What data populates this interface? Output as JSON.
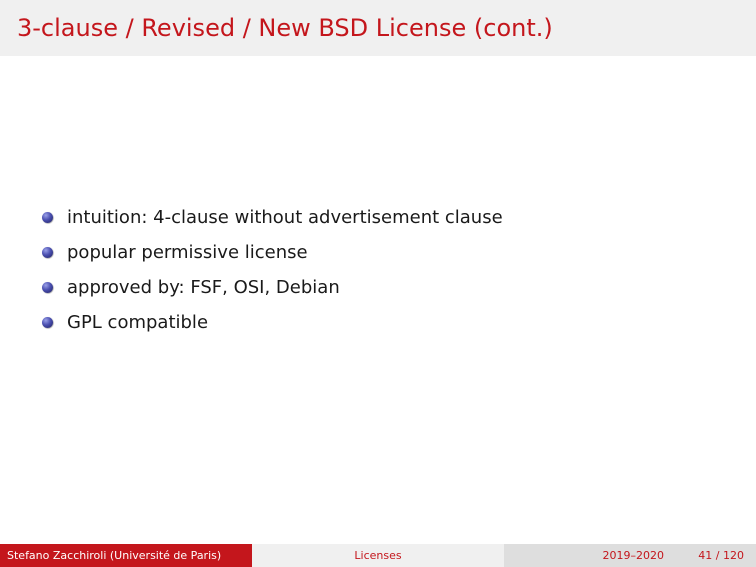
{
  "slide": {
    "title": "3-clause / Revised / New BSD License (cont.)",
    "bullets": [
      "intuition: 4-clause without advertisement clause",
      "popular permissive license",
      "approved by: FSF, OSI, Debian",
      "GPL compatible"
    ]
  },
  "footer": {
    "author": "Stefano Zacchiroli  (Université de Paris)",
    "section": "Licenses",
    "date": "2019–2020",
    "page": "41 / 120"
  },
  "colors": {
    "accent": "#c4161c",
    "title_bar_bg": "#f0f0f0",
    "bullet": "#3b3f9e"
  }
}
